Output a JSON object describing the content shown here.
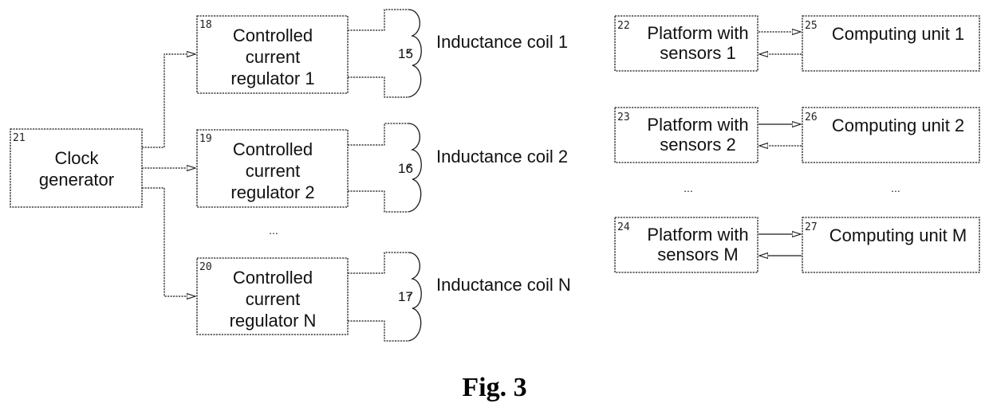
{
  "figure": {
    "caption": "Fig. 3",
    "clock_generator": {
      "ref": "21",
      "lines": [
        "Clock",
        "generator"
      ]
    },
    "regulators": [
      {
        "ref": "18",
        "lines": [
          "Controlled",
          "current",
          "regulator 1"
        ]
      },
      {
        "ref": "19",
        "lines": [
          "Controlled",
          "current",
          "regulator 2"
        ]
      },
      {
        "ref": "20",
        "lines": [
          "Controlled",
          "current",
          "regulator N"
        ]
      }
    ],
    "coils": [
      {
        "ref": "15",
        "label": "Inductance coil 1"
      },
      {
        "ref": "16",
        "label": "Inductance coil 2"
      },
      {
        "ref": "17",
        "label": "Inductance coil N"
      }
    ],
    "platforms": [
      {
        "ref": "22",
        "lines": [
          "Platform with",
          "sensors 1"
        ]
      },
      {
        "ref": "23",
        "lines": [
          "Platform with",
          "sensors 2"
        ]
      },
      {
        "ref": "24",
        "lines": [
          "Platform with",
          "sensors M"
        ]
      }
    ],
    "computing_units": [
      {
        "ref": "25",
        "label": "Computing unit 1"
      },
      {
        "ref": "26",
        "label": "Computing unit 2"
      },
      {
        "ref": "27",
        "label": "Computing unit M"
      }
    ],
    "ellipsis": "..."
  }
}
